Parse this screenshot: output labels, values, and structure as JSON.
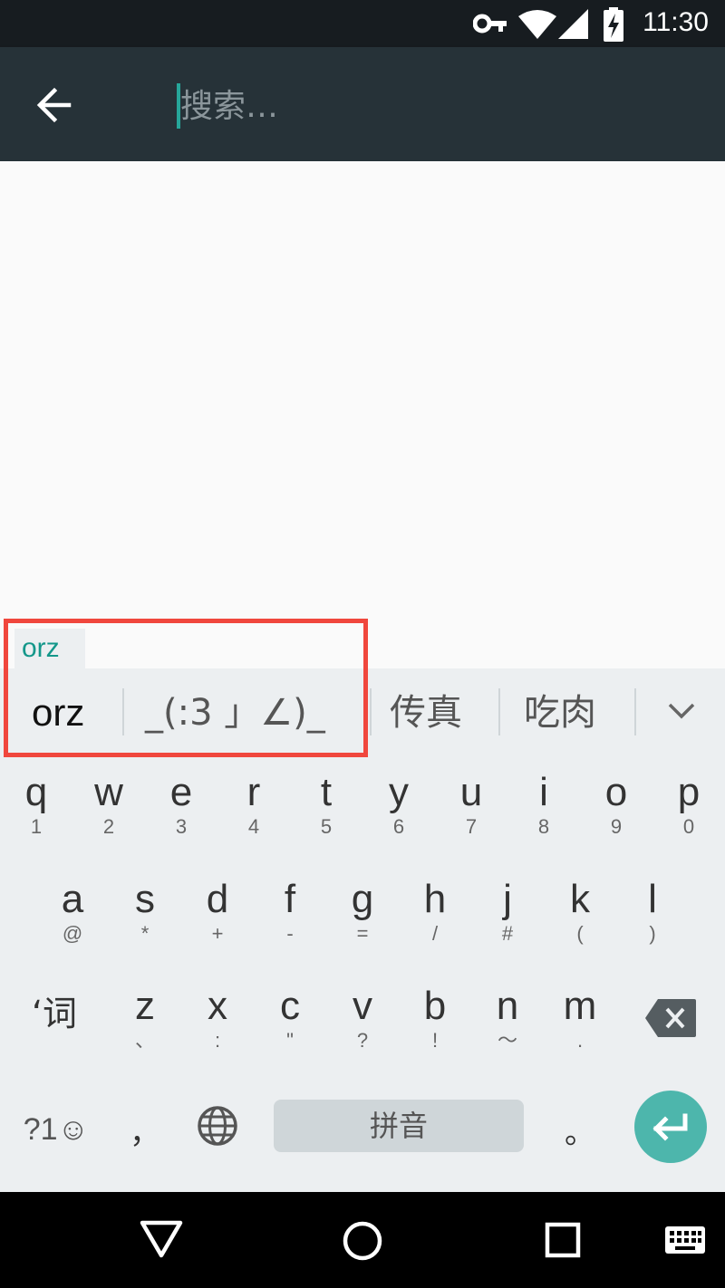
{
  "status_bar": {
    "time": "11:30",
    "icons": [
      "vpn-key-icon",
      "wifi-icon",
      "cell-signal-icon",
      "battery-charging-icon"
    ]
  },
  "app_bar": {
    "back_icon": "arrow-left-icon",
    "search_placeholder": "搜索…",
    "search_value": ""
  },
  "ime": {
    "composing_text": "orz",
    "candidates": [
      "orz",
      "_(:3 」∠)_",
      "传真",
      "吃肉"
    ],
    "expand_icon": "chevron-down-icon",
    "rows": [
      [
        {
          "main": "q",
          "sub": "1"
        },
        {
          "main": "w",
          "sub": "2"
        },
        {
          "main": "e",
          "sub": "3"
        },
        {
          "main": "r",
          "sub": "4"
        },
        {
          "main": "t",
          "sub": "5"
        },
        {
          "main": "y",
          "sub": "6"
        },
        {
          "main": "u",
          "sub": "7"
        },
        {
          "main": "i",
          "sub": "8"
        },
        {
          "main": "o",
          "sub": "9"
        },
        {
          "main": "p",
          "sub": "0"
        }
      ],
      [
        {
          "main": "a",
          "sub": "@"
        },
        {
          "main": "s",
          "sub": "*"
        },
        {
          "main": "d",
          "sub": "+"
        },
        {
          "main": "f",
          "sub": "-"
        },
        {
          "main": "g",
          "sub": "="
        },
        {
          "main": "h",
          "sub": "/"
        },
        {
          "main": "j",
          "sub": "#"
        },
        {
          "main": "k",
          "sub": "("
        },
        {
          "main": "l",
          "sub": ")"
        }
      ],
      [
        {
          "main": "‘词",
          "sub": ""
        },
        {
          "main": "z",
          "sub": "、"
        },
        {
          "main": "x",
          "sub": ":"
        },
        {
          "main": "c",
          "sub": "\""
        },
        {
          "main": "v",
          "sub": "?"
        },
        {
          "main": "b",
          "sub": "!"
        },
        {
          "main": "n",
          "sub": "～"
        },
        {
          "main": "m",
          "sub": "."
        }
      ]
    ],
    "bottom_row": {
      "symbols_label": "?1☺",
      "comma_label": "，",
      "globe_icon": "globe-icon",
      "space_label": "拼音",
      "period_label": "。",
      "enter_icon": "enter-icon"
    },
    "delete_icon": "backspace-icon"
  },
  "nav_bar": {
    "icons": [
      "back-triangle-icon",
      "home-circle-icon",
      "recents-square-icon",
      "keyboard-switch-icon"
    ]
  },
  "colors": {
    "status_bar": "#171c20",
    "app_bar": "#263238",
    "accent": "#26a69a",
    "keyboard_bg": "#eceff1",
    "highlight": "#f0473d"
  }
}
